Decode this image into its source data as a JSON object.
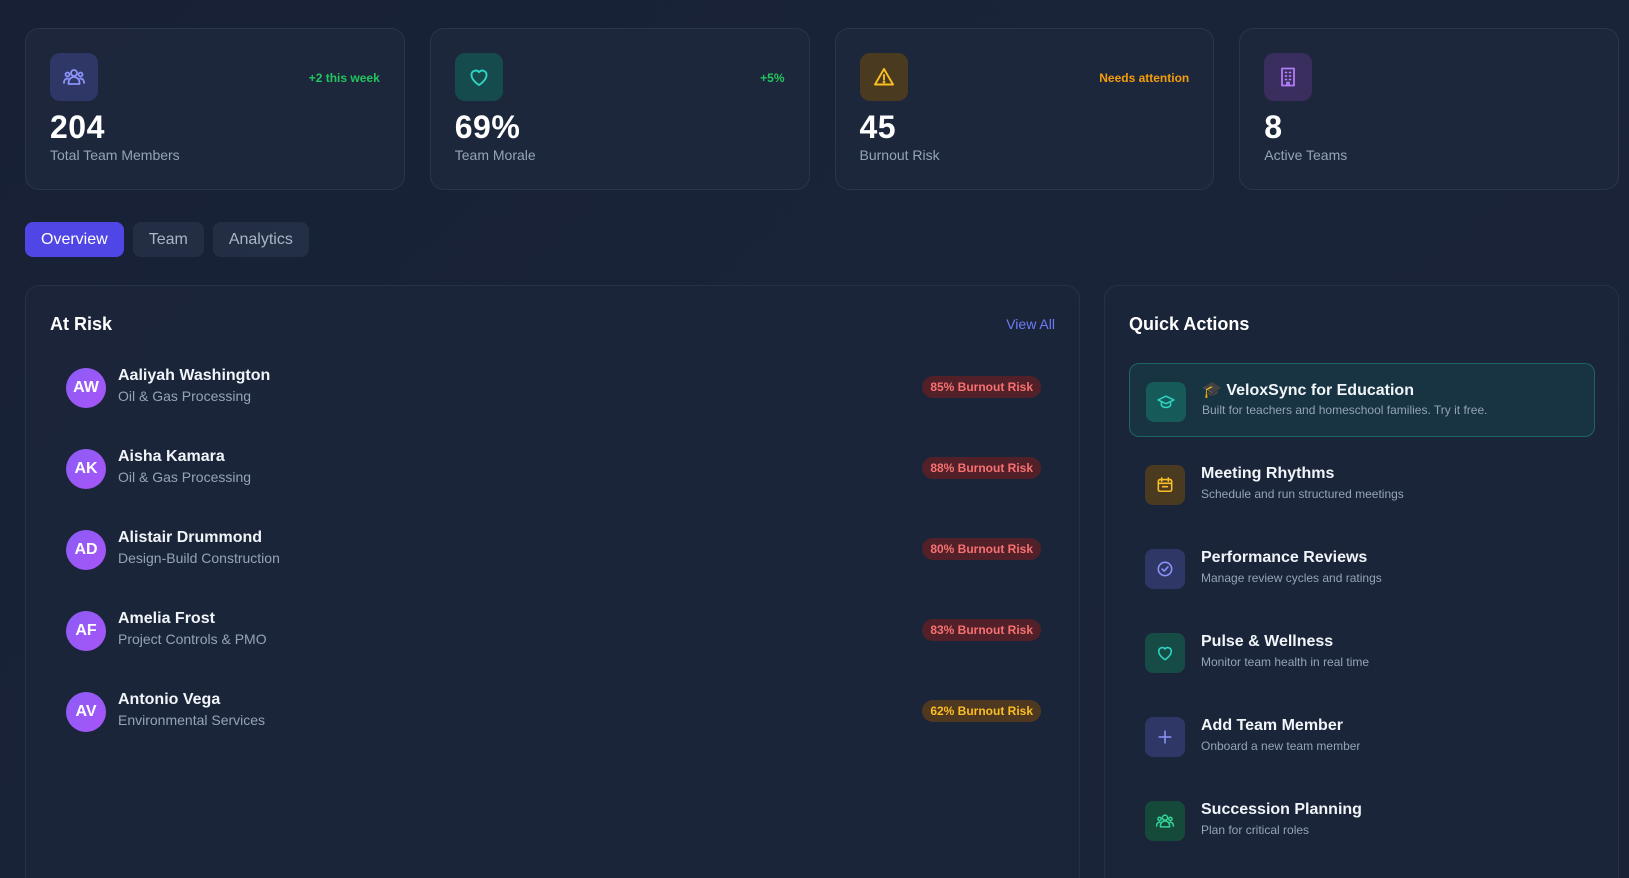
{
  "stats": [
    {
      "value": "204",
      "label": "Total Team Members",
      "badge": "+2 this week",
      "icon": "users-icon"
    },
    {
      "value": "69%",
      "label": "Team Morale",
      "badge": "+5%",
      "icon": "heart-icon"
    },
    {
      "value": "45",
      "label": "Burnout Risk",
      "badge": "Needs attention",
      "icon": "warning-icon"
    },
    {
      "value": "8",
      "label": "Active Teams",
      "badge": "",
      "icon": "building-icon"
    }
  ],
  "colors": {
    "accent": "#4f46e5",
    "positive": "#22c55e",
    "warning": "#f59e0b",
    "danger": "#f87171",
    "link": "#6d7cf8"
  },
  "tabs": [
    {
      "label": "Overview",
      "active": true
    },
    {
      "label": "Team",
      "active": false
    },
    {
      "label": "Analytics",
      "active": false
    }
  ],
  "at_risk": {
    "title": "At Risk",
    "view_all": "View All",
    "people": [
      {
        "initials": "AW",
        "name": "Aaliyah Washington",
        "dept": "Oil & Gas Processing",
        "risk": "85% Burnout Risk"
      },
      {
        "initials": "AK",
        "name": "Aisha Kamara",
        "dept": "Oil & Gas Processing",
        "risk": "88% Burnout Risk"
      },
      {
        "initials": "AD",
        "name": "Alistair Drummond",
        "dept": "Design-Build Construction",
        "risk": "80% Burnout Risk"
      },
      {
        "initials": "AF",
        "name": "Amelia Frost",
        "dept": "Project Controls & PMO",
        "risk": "83% Burnout Risk"
      },
      {
        "initials": "AV",
        "name": "Antonio Vega",
        "dept": "Environmental Services",
        "risk": "62% Burnout Risk"
      }
    ]
  },
  "quick_actions": {
    "title": "Quick Actions",
    "items": [
      {
        "title": "🎓 VeloxSync for Education",
        "desc": "Built for teachers and homeschool families. Try it free.",
        "icon": "graduation-cap-icon"
      },
      {
        "title": "Meeting Rhythms",
        "desc": "Schedule and run structured meetings",
        "icon": "calendar-icon"
      },
      {
        "title": "Performance Reviews",
        "desc": "Manage review cycles and ratings",
        "icon": "check-badge-icon"
      },
      {
        "title": "Pulse & Wellness",
        "desc": "Monitor team health in real time",
        "icon": "heart-icon"
      },
      {
        "title": "Add Team Member",
        "desc": "Onboard a new team member",
        "icon": "plus-icon"
      },
      {
        "title": "Succession Planning",
        "desc": "Plan for critical roles",
        "icon": "users-icon"
      }
    ]
  }
}
